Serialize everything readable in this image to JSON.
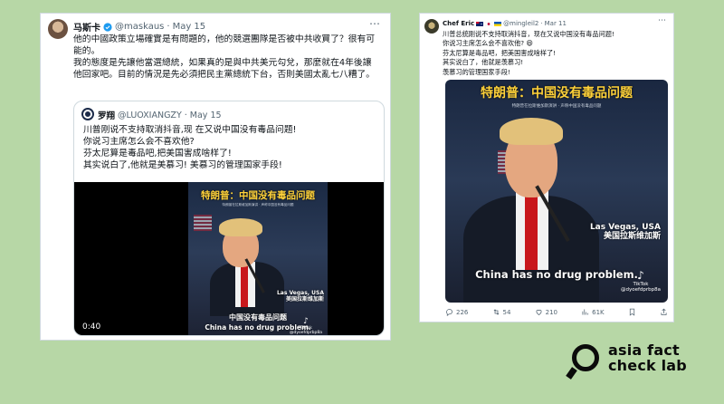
{
  "left_tweet": {
    "author_name": "马斯卡",
    "handle": "@maskaus",
    "separator": "·",
    "date": "May 15",
    "more_icon": "⋯",
    "text_lines": [
      "他的中國政策立場確實是有問題的，他的競選團隊是否被中共收買了？很有可",
      "能的。",
      "我的態度是先讓他當選總統，如果真的是與中共美元勾兌，那麼就在4年後讓",
      "他回家吧。目前的情況是先必須把民主黨總統下台，否則美國太亂七八糟了。"
    ],
    "quote": {
      "author_name": "罗翔",
      "handle": "@LUOXIANGZY",
      "separator": "·",
      "date": "May 15",
      "text_lines": [
        "川普刚说不支持取消抖音,现 在又说中国没有毒品问题!",
        "你说习主席怎么会不喜欢他?",
        "芬太尼算是毒品吧,把美国害成啥样了!",
        "其实说白了,他就是美慕习! 美慕习的管理国家手段!"
      ],
      "video": {
        "banner": "特朗普：中国没有毒品问题",
        "subbanner": "特朗普在拉斯维加斯演讲 · 声称中国没有毒品问题",
        "location_en": "Las Vegas, USA",
        "location_cn": "美国拉斯维加斯",
        "subtitle_cn": "中国没有毒品问题",
        "subtitle_en": "China has no drug problem.",
        "tiktok_label": "TikTok",
        "tiktok_user": "@dyoefdprbp8a",
        "duration": "0:40"
      }
    }
  },
  "right_tweet": {
    "author_name": "Chef Eric",
    "handle": "@mingleil2",
    "separator": "·",
    "date": "Mar 11",
    "more_icon": "⋯",
    "text_lines": [
      "川普总统刚说不支持取消抖音，现在又说中国没有毒品问题!",
      "你说习主席怎么会不喜欢他? 😄",
      "芬太尼算是毒品吧，把美国害成啥样了!",
      "其实说白了，他就是羡慕习!",
      "羡慕习的管理国家手段!"
    ],
    "video": {
      "banner": "特朗普：中国没有毒品问题",
      "subbanner": "特朗普在拉斯维加斯演讲 · 声称中国没有毒品问题",
      "location_en": "Las Vegas, USA",
      "location_cn": "美国拉斯维加斯",
      "subtitle_en": "China has no drug problem.",
      "tiktok_label": "TikTok",
      "tiktok_user": "@dyoefdprbp8a"
    },
    "metrics": {
      "replies": "226",
      "reposts": "54",
      "likes": "210",
      "views": "61K"
    }
  },
  "logo": {
    "line1": "asia fact",
    "line2": "check lab"
  },
  "colors": {
    "background": "#b7d7a6",
    "banner_yellow": "#ffd23a",
    "tie_red": "#c8171c",
    "verified_blue": "#1d9bf0"
  }
}
